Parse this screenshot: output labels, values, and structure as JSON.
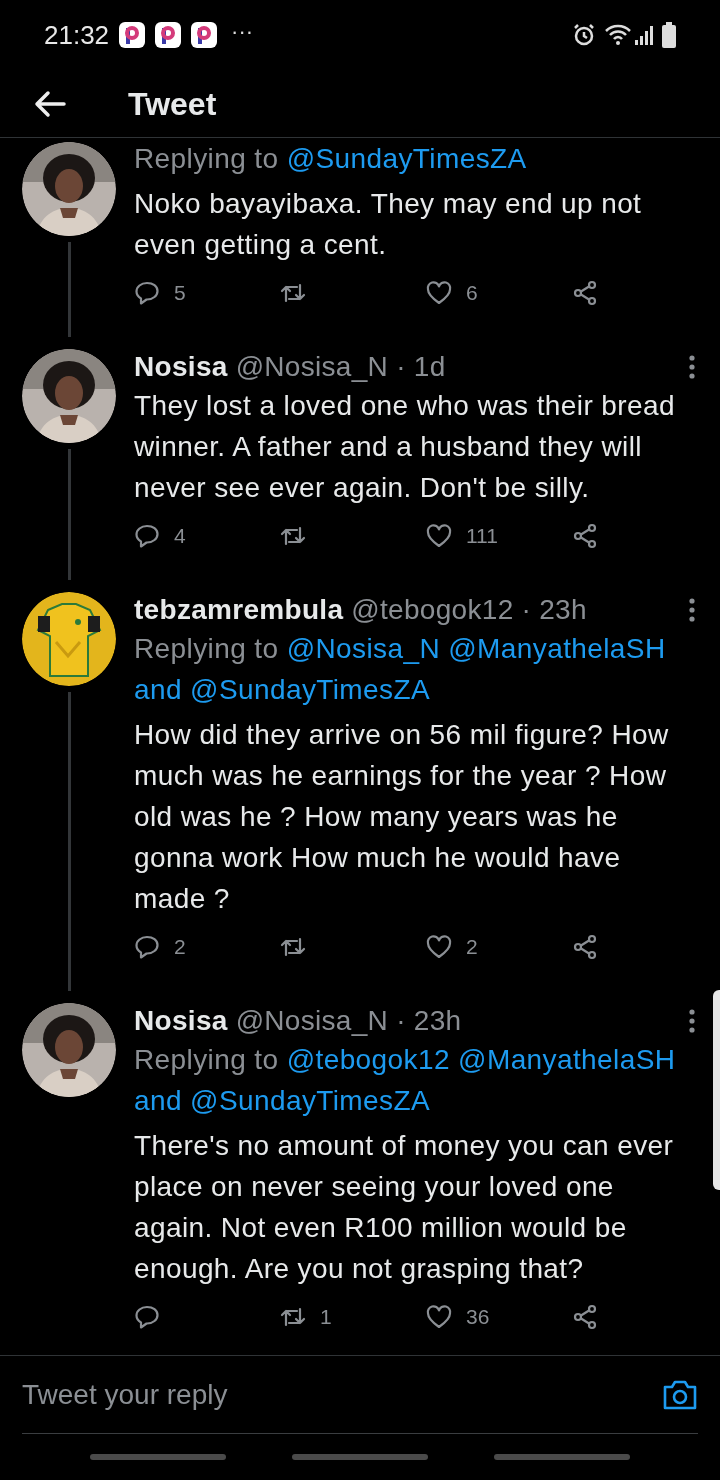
{
  "status_bar": {
    "time": "21:32",
    "more": "···"
  },
  "header": {
    "title": "Tweet"
  },
  "tweets": [
    {
      "replying": {
        "prefix": "Replying to",
        "parts": [
          "@SundayTimesZA"
        ]
      },
      "text": "Noko bayayibaxa. They may end up not even getting a cent.",
      "replies": "5",
      "likes": "6",
      "thread_line": true,
      "menu": false
    },
    {
      "name": "Nosisa",
      "handle": "@Nosisa_N",
      "time": "· 1d",
      "text": "They lost a loved one who was their bread winner. A father and a husband they will never see ever again. Don't be silly.",
      "replies": "4",
      "likes": "111",
      "thread_line": true,
      "menu": true
    },
    {
      "name": "tebzamrembula",
      "handle": "@tebogok12",
      "time": "· 23h",
      "replying": {
        "prefix": "Replying to",
        "parts": [
          "@Nosisa_N",
          "@ManyathelaSH",
          "and @SundayTimesZA"
        ]
      },
      "text": "How did they arrive on 56 mil figure? How much was he earnings for the year ? How old was he ? How many years was he gonna work How much he would have made ?",
      "replies": "2",
      "likes": "2",
      "thread_line": true,
      "menu": true
    },
    {
      "name": "Nosisa",
      "handle": "@Nosisa_N",
      "time": "· 23h",
      "replying": {
        "prefix": "Replying to",
        "parts": [
          "@tebogok12",
          "@ManyathelaSH",
          "and @SundayTimesZA"
        ]
      },
      "text": "There's no amount of money you can ever place on never seeing your loved one again. Not even R100 million would be enough. Are you not grasping that?",
      "retweets": "1",
      "likes": "36",
      "thread_line": false,
      "menu": true
    }
  ],
  "reply_box": {
    "placeholder": "Tweet your reply"
  }
}
